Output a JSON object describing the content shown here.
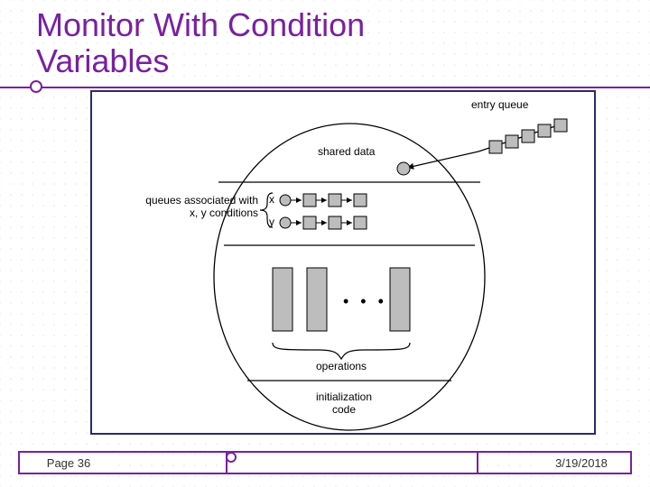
{
  "title_line1": "Monitor With Condition",
  "title_line2": "Variables",
  "footer": {
    "page": "Page 36",
    "date": "3/19/2018"
  },
  "diagram": {
    "entry_queue": "entry queue",
    "shared_data": "shared data",
    "queues_assoc_line1": "queues associated with",
    "queues_assoc_line2": "x, y conditions",
    "x": "x",
    "y": "y",
    "ellipsis": "• • •",
    "operations": "operations",
    "init_line1": "initialization",
    "init_line2": "code"
  }
}
